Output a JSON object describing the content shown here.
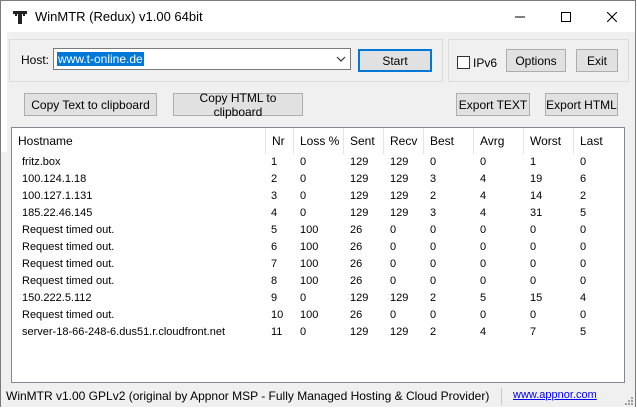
{
  "window": {
    "title": "WinMTR (Redux) v1.00 64bit"
  },
  "host": {
    "label": "Host:",
    "value": "www.t-online.de"
  },
  "buttons": {
    "start": "Start",
    "options": "Options",
    "exit": "Exit",
    "copy_text": "Copy Text to clipboard",
    "copy_html": "Copy HTML to clipboard",
    "export_text": "Export TEXT",
    "export_html": "Export HTML"
  },
  "ipv6": {
    "label": "IPv6",
    "checked": false
  },
  "table": {
    "columns": [
      "Hostname",
      "Nr",
      "Loss %",
      "Sent",
      "Recv",
      "Best",
      "Avrg",
      "Worst",
      "Last"
    ],
    "rows": [
      [
        "fritz.box",
        "1",
        "0",
        "129",
        "129",
        "0",
        "0",
        "1",
        "0"
      ],
      [
        "100.124.1.18",
        "2",
        "0",
        "129",
        "129",
        "3",
        "4",
        "19",
        "6"
      ],
      [
        "100.127.1.131",
        "3",
        "0",
        "129",
        "129",
        "2",
        "4",
        "14",
        "2"
      ],
      [
        "185.22.46.145",
        "4",
        "0",
        "129",
        "129",
        "3",
        "4",
        "31",
        "5"
      ],
      [
        "Request timed out.",
        "5",
        "100",
        "26",
        "0",
        "0",
        "0",
        "0",
        "0"
      ],
      [
        "Request timed out.",
        "6",
        "100",
        "26",
        "0",
        "0",
        "0",
        "0",
        "0"
      ],
      [
        "Request timed out.",
        "7",
        "100",
        "26",
        "0",
        "0",
        "0",
        "0",
        "0"
      ],
      [
        "Request timed out.",
        "8",
        "100",
        "26",
        "0",
        "0",
        "0",
        "0",
        "0"
      ],
      [
        "150.222.5.112",
        "9",
        "0",
        "129",
        "129",
        "2",
        "5",
        "15",
        "4"
      ],
      [
        "Request timed out.",
        "10",
        "100",
        "26",
        "0",
        "0",
        "0",
        "0",
        "0"
      ],
      [
        "server-18-66-248-6.dus51.r.cloudfront.net",
        "11",
        "0",
        "129",
        "129",
        "2",
        "4",
        "7",
        "5"
      ]
    ]
  },
  "status": {
    "text": "WinMTR v1.00 GPLv2 (original by Appnor MSP - Fully Managed Hosting & Cloud Provider)",
    "link": "www.appnor.com"
  },
  "colors": {
    "selection": "#0078d7",
    "button_face": "#e1e1e1",
    "link": "#0000ee"
  },
  "icons": [
    "app-icon",
    "minimize-icon",
    "maximize-icon",
    "close-icon",
    "dropdown-arrow-icon",
    "size-grip-icon"
  ]
}
